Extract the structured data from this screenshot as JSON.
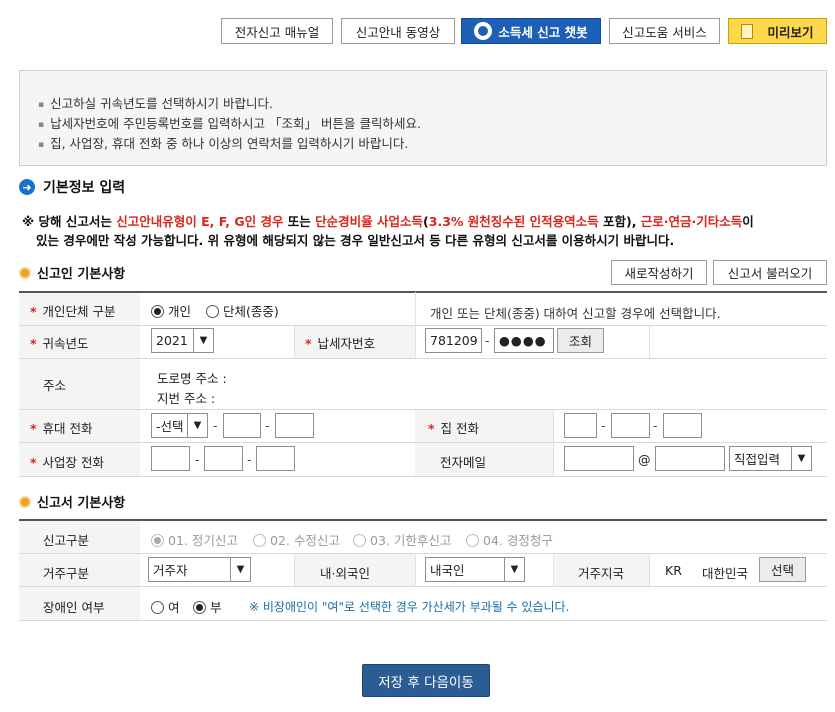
{
  "top_buttons": {
    "manual": "전자신고 매뉴얼",
    "video": "신고안내 동영상",
    "chatbot": "소득세 신고 챗봇",
    "help": "신고도움 서비스",
    "preview": "미리보기"
  },
  "notice": [
    "신고하실 귀속년도를 선택하시기 바랍니다.",
    "납세자번호에 주민등록번호를 입력하시고 「조회」 버튼을 클릭하세요.",
    "집, 사업장, 휴대 전화 중 하나 이상의 연락처를 입력하시기 바랍니다."
  ],
  "section_title": "기본정보 입력",
  "warning": {
    "p1": "※ 당해 신고서는 ",
    "r1": "신고안내유형이 E, F, G인 경우",
    "p2": " 또는 ",
    "r2": "단순경비율 사업소득",
    "p3": "(",
    "r3": "3.3% 원천징수된 인적용역소득",
    "p4": " 포함), ",
    "r4": "근로·연금·기타소득",
    "p5": "이",
    "line2": "있는 경우에만 작성 가능합니다. 위 유형에 해당되지 않는 경우 일반신고서 등 다른 유형의 신고서를 이용하시기 바랍니다."
  },
  "filer": {
    "title": "신고인 기본사항",
    "new_button": "새로작성하기",
    "load_button": "신고서 불러오기",
    "type_label": "개인단체 구분",
    "type_individual": "개인",
    "type_group": "단체(종중)",
    "type_help": "개인 또는 단체(종중) 대하여 신고할 경우에 선택합니다.",
    "year_label": "귀속년도",
    "year_value": "2021",
    "taxpayer_label": "납세자번호",
    "taxpayer_front": "781209",
    "taxpayer_back": "●●●●",
    "lookup_button": "조회",
    "address_label": "주소",
    "road_address": "도로명 주소 :",
    "lot_address": "지번 주소 :",
    "mobile_label": "휴대 전화",
    "mobile_select": "-선택",
    "home_label": "집 전화",
    "business_label": "사업장 전화",
    "email_label": "전자메일",
    "email_at": "@",
    "email_domain_select": "직접입력"
  },
  "report": {
    "title": "신고서 기본사항",
    "category_label": "신고구분",
    "options": [
      "01. 정기신고",
      "02. 수정신고",
      "03. 기한후신고",
      "04. 경정청구"
    ],
    "residence_label": "거주구분",
    "residence_value": "거주자",
    "nationality_label": "내·외국인",
    "nationality_value": "내국인",
    "region_label": "거주지국",
    "region_code": "KR",
    "region_name": "대한민국",
    "region_button": "선택",
    "disabled_label": "장애인 여부",
    "disabled_yes": "여",
    "disabled_no": "부",
    "disabled_note": "※ 비장애인이 \"여\"로 선택한 경우 가산세가 부과될 수 있습니다."
  },
  "save_button": "저장 후 다음이동"
}
